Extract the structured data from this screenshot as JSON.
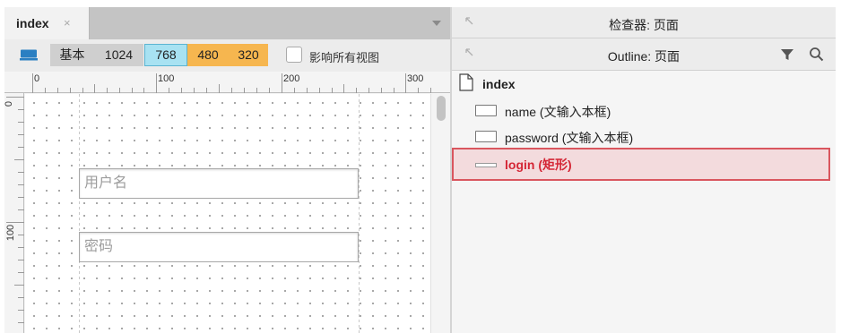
{
  "editor": {
    "tab_title": "index",
    "tab_close": "×",
    "breakpoints": [
      "基本",
      "1024",
      "768",
      "480",
      "320"
    ],
    "active_breakpoint": "768",
    "affect_all_views_label": "影响所有视图",
    "affect_all_views_checked": false,
    "ruler_top_labels": [
      "0",
      "100",
      "200",
      "300"
    ],
    "ruler_left_labels": [
      "0",
      "100"
    ],
    "fields": [
      {
        "placeholder": "用户名"
      },
      {
        "placeholder": "密码"
      }
    ]
  },
  "inspector": {
    "title": "检查器: 页面"
  },
  "outline": {
    "title": "Outline: 页面",
    "root": "index",
    "items": [
      {
        "label": "name (文输入本框)",
        "icon": "text-field-icon",
        "selected": false
      },
      {
        "label": "password (文输入本框)",
        "icon": "text-field-icon",
        "selected": false
      },
      {
        "label": "login (矩形)",
        "icon": "rectangle-icon",
        "selected": true
      }
    ]
  },
  "colors": {
    "active_breakpoint": "#a8e2f2",
    "small_breakpoints": "#f6b64f",
    "selection_highlight": "#d42635"
  }
}
